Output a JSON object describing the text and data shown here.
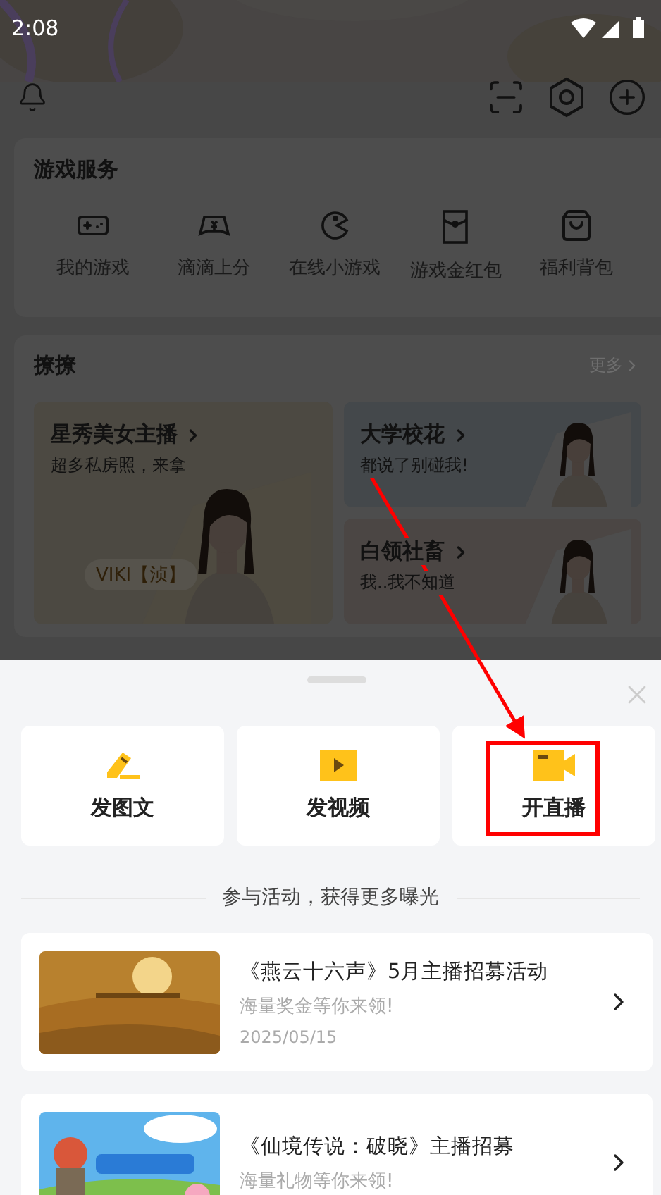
{
  "status_bar": {
    "time": "2:08"
  },
  "game_services": {
    "title": "游戏服务",
    "items": [
      {
        "label": "我的游戏",
        "kind": "gamepad"
      },
      {
        "label": "滴滴上分",
        "kind": "rank"
      },
      {
        "label": "在线小游戏",
        "kind": "pacman"
      },
      {
        "label": "游戏金红包",
        "kind": "envelope"
      },
      {
        "label": "福利背包",
        "kind": "bag"
      }
    ]
  },
  "flirt": {
    "title": "撩撩",
    "more": "更多",
    "cards": [
      {
        "title": "星秀美女主播",
        "subtitle": "超多私房照，来拿",
        "tag": "VIKI【浈】",
        "kind": "large"
      },
      {
        "title": "大学校花",
        "subtitle": "都说了别碰我!",
        "kind": "small"
      },
      {
        "title": "白领社畜",
        "subtitle": "我..我不知道",
        "kind": "small"
      }
    ]
  },
  "sheet": {
    "actions": [
      {
        "label": "发图文",
        "kind": "post"
      },
      {
        "label": "发视频",
        "kind": "video"
      },
      {
        "label": "开直播",
        "kind": "live"
      }
    ],
    "activities_heading": "参与活动，获得更多曝光",
    "activities": [
      {
        "title": "《燕云十六声》5月主播招募活动",
        "subtitle": "海量奖金等你来领!",
        "date": "2025/05/15",
        "kind": "desert"
      },
      {
        "title": "《仙境传说：破晓》主播招募",
        "subtitle": "海量礼物等你来领!",
        "kind": "sky"
      }
    ]
  }
}
